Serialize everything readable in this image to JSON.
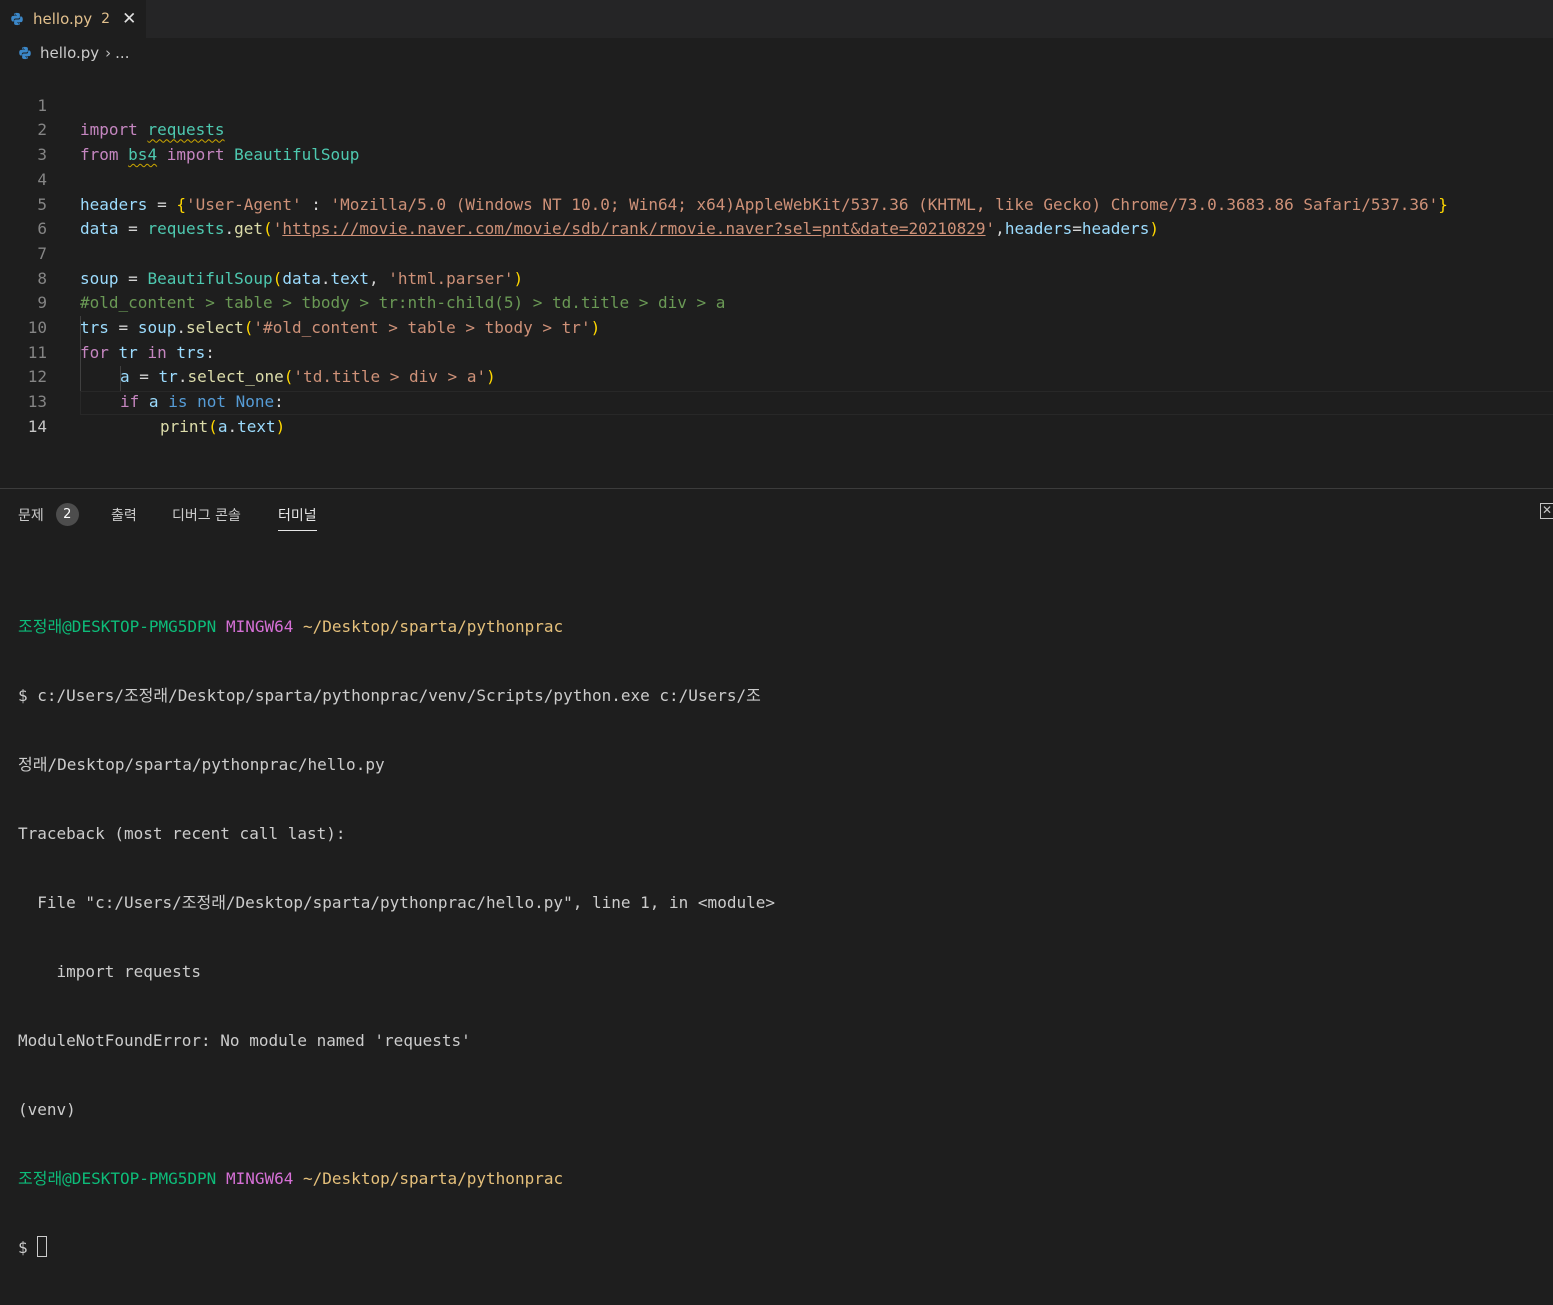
{
  "tab": {
    "filename": "hello.py",
    "problem_count": "2",
    "icon": "python-icon",
    "close": "✕"
  },
  "breadcrumb": {
    "file": "hello.py",
    "separator": "›",
    "more": "..."
  },
  "editor": {
    "line_numbers": [
      "1",
      "2",
      "3",
      "4",
      "5",
      "6",
      "7",
      "8",
      "9",
      "10",
      "11",
      "12",
      "13",
      "14"
    ],
    "active_line": "14",
    "lines": {
      "l1": [
        "import",
        " ",
        "requests"
      ],
      "l2": [
        "from",
        " ",
        "bs4",
        " ",
        "import",
        " ",
        "BeautifulSoup"
      ],
      "l4": [
        "headers",
        " = ",
        "{",
        "'User-Agent'",
        " : ",
        "'Mozilla/5.0 (Windows NT 10.0; Win64; x64)AppleWebKit/537.36 (KHTML, like Gecko) Chrome/73.0.3683.86 Safari/537.36'",
        "}"
      ],
      "l5": [
        "data",
        " = ",
        "requests",
        ".",
        "get",
        "(",
        "'",
        "https://movie.naver.com/movie/sdb/rank/rmovie.naver?sel=pnt&date=20210829",
        "'",
        ",",
        "headers",
        "=",
        "headers",
        ")"
      ],
      "l7": [
        "soup",
        " = ",
        "BeautifulSoup",
        "(",
        "data",
        ".",
        "text",
        ", ",
        "'html.parser'",
        ")"
      ],
      "l8": "#old_content > table > tbody > tr:nth-child(5) > td.title > div > a",
      "l9": [
        "trs",
        " = ",
        "soup",
        ".",
        "select",
        "(",
        "'#old_content > table > tbody > tr'",
        ")"
      ],
      "l10": [
        "for",
        " ",
        "tr",
        " ",
        "in",
        " ",
        "trs",
        ":"
      ],
      "l11": [
        "a",
        " = ",
        "tr",
        ".",
        "select_one",
        "(",
        "'td.title > div > a'",
        ")"
      ],
      "l12": [
        "if",
        " ",
        "a",
        " ",
        "is",
        " ",
        "not",
        " ",
        "None",
        ":"
      ],
      "l13": [
        "print",
        "(",
        "a",
        ".",
        "text",
        ")"
      ]
    }
  },
  "panel": {
    "tabs": {
      "problems": "문제",
      "problems_count": "2",
      "output": "출력",
      "debug_console": "디버그 콘솔",
      "terminal": "터미널"
    },
    "close_icon": "panel-close-icon"
  },
  "terminal": {
    "user": "조정래",
    "host": "@DESKTOP-PMG5DPN",
    "shell": "MINGW64",
    "path": "~/Desktop/sparta/pythonprac",
    "cmd_line1": "$ c:/Users/조정래/Desktop/sparta/pythonprac/venv/Scripts/python.exe c:/Users/조",
    "cmd_line2": "정래/Desktop/sparta/pythonprac/hello.py",
    "tb1": "Traceback (most recent call last):",
    "tb2": "  File \"c:/Users/조정래/Desktop/sparta/pythonprac/hello.py\", line 1, in <module>",
    "tb3": "    import requests",
    "tb4": "ModuleNotFoundError: No module named 'requests'",
    "venv": "(venv)",
    "prompt": "$ "
  },
  "colors": {
    "background": "#1e1e1e",
    "tab_modified": "#e2c08d",
    "keyword": "#c586c0",
    "string": "#ce9178",
    "comment": "#6a9955"
  }
}
